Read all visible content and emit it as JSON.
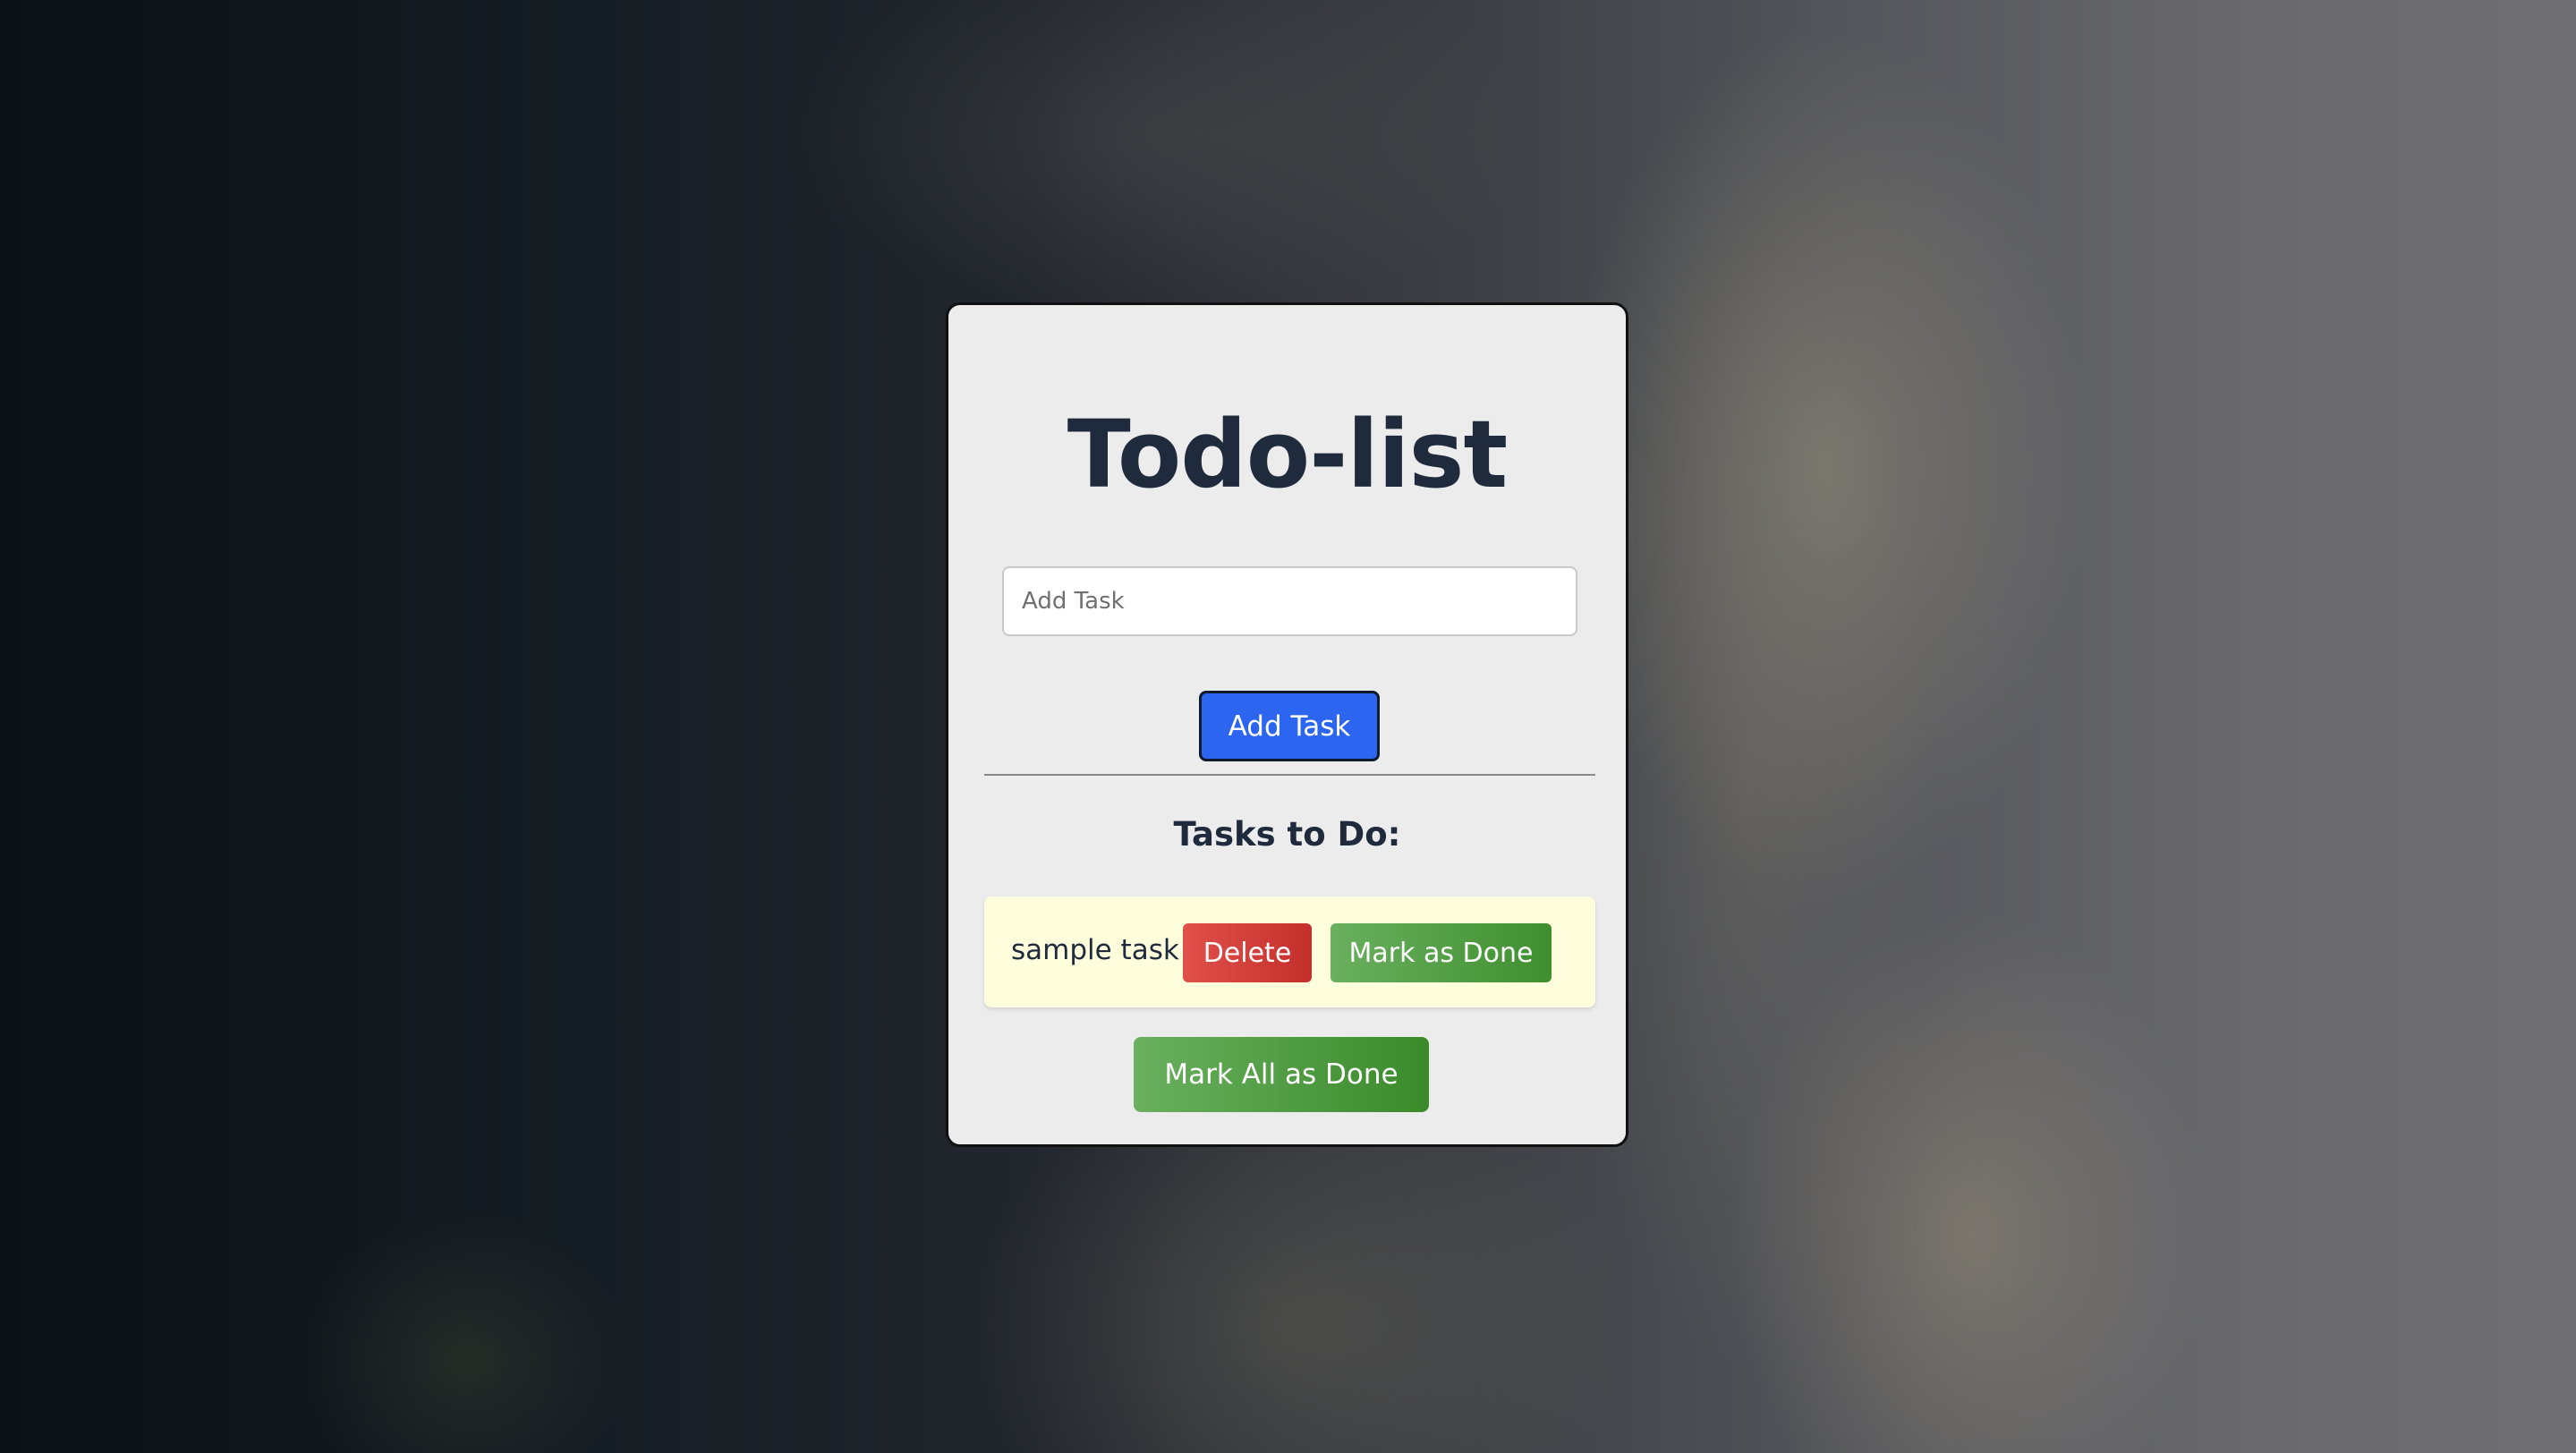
{
  "app": {
    "title": "Todo-list"
  },
  "new_task": {
    "value": "",
    "placeholder": "Add Task"
  },
  "actions": {
    "add_label": "Add Task",
    "mark_all_label": "Mark All as Done"
  },
  "tasks_section": {
    "heading": "Tasks to Do:",
    "tasks": [
      {
        "text": "sample task",
        "delete_label": "Delete",
        "done_label": "Mark as Done"
      }
    ]
  },
  "colors": {
    "primary": "#2c66f0",
    "danger": "#d9443f",
    "success": "#52a046",
    "task_background": "#fefedd",
    "card_background": "#ececec",
    "heading_text": "#1f2b3d"
  }
}
